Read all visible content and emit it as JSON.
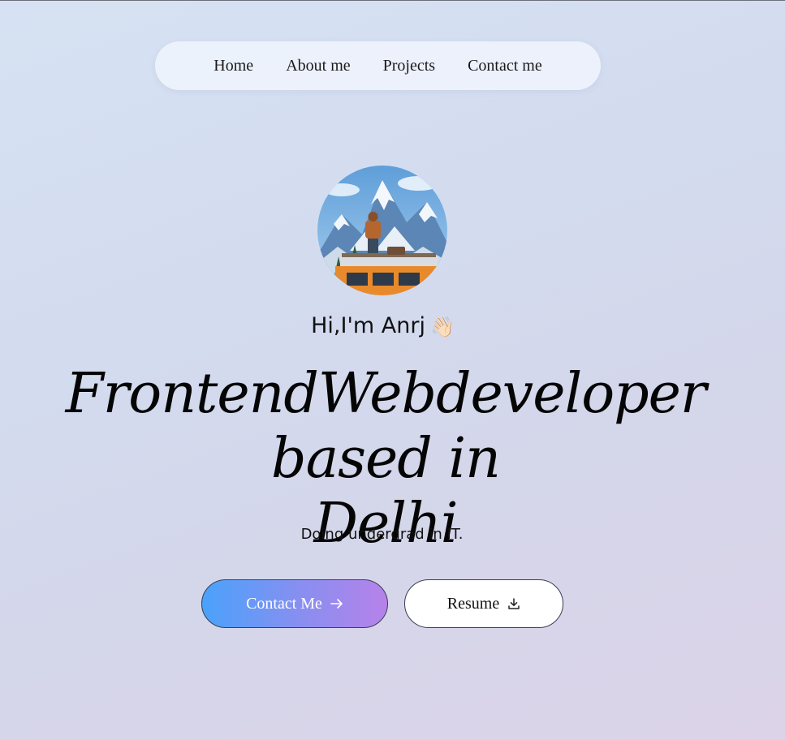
{
  "nav": {
    "items": [
      {
        "label": "Home"
      },
      {
        "label": "About me"
      },
      {
        "label": "Projects"
      },
      {
        "label": "Contact me"
      }
    ]
  },
  "hero": {
    "greeting": "Hi,I'm Anrj",
    "wave_emoji": "👋🏻",
    "headline_line1": "FrontendWebdeveloper based in",
    "headline_line2": "Delhi",
    "subtitle": "Doing undergrad in IT."
  },
  "buttons": {
    "contact_label": "Contact Me",
    "contact_icon": "arrow-right-icon",
    "resume_label": "Resume",
    "resume_icon": "download-icon"
  },
  "colors": {
    "contact_gradient_start": "#4aa2fb",
    "contact_gradient_end": "#b782ea",
    "nav_background": "#eef3fc"
  }
}
